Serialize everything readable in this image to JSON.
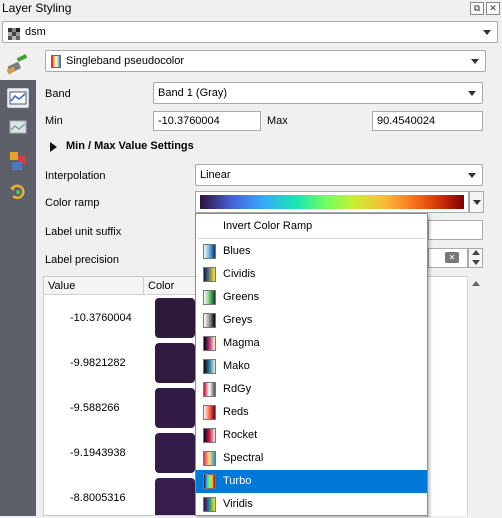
{
  "window": {
    "title": "Layer Styling",
    "float_glyph": "⧉",
    "close_glyph": "✕"
  },
  "layer_selector": {
    "value": "dsm"
  },
  "renderer": {
    "value": "Singleband pseudocolor"
  },
  "band": {
    "label": "Band",
    "value": "Band 1 (Gray)"
  },
  "min": {
    "label": "Min",
    "value": "-10.3760004"
  },
  "max": {
    "label": "Max",
    "value": "90.4540024"
  },
  "minmax_section": {
    "label": "Min / Max Value Settings"
  },
  "interpolation": {
    "label": "Interpolation",
    "value": "Linear"
  },
  "color_ramp": {
    "label": "Color ramp"
  },
  "label_unit_suffix": {
    "label": "Label unit suffix"
  },
  "label_precision": {
    "label": "Label precision"
  },
  "table": {
    "headers": [
      "Value",
      "Color"
    ],
    "rows": [
      {
        "value": "-10.3760004",
        "color": "#2e1a3a"
      },
      {
        "value": "-9.9821282",
        "color": "#301a3f"
      },
      {
        "value": "-9.588266",
        "color": "#321b44"
      },
      {
        "value": "-9.1943938",
        "color": "#341c48"
      },
      {
        "value": "-8.8005316",
        "color": "#361d4d"
      }
    ]
  },
  "ramp_menu": {
    "invert_label": "Invert Color Ramp",
    "items": [
      {
        "label": "Blues",
        "icon": "blues-ramp-icon"
      },
      {
        "label": "Cividis",
        "icon": "cividis-ramp-icon"
      },
      {
        "label": "Greens",
        "icon": "greens-ramp-icon"
      },
      {
        "label": "Greys",
        "icon": "greys-ramp-icon"
      },
      {
        "label": "Magma",
        "icon": "magma-ramp-icon"
      },
      {
        "label": "Mako",
        "icon": "mako-ramp-icon"
      },
      {
        "label": "RdGy",
        "icon": "rdgy-ramp-icon"
      },
      {
        "label": "Reds",
        "icon": "reds-ramp-icon"
      },
      {
        "label": "Rocket",
        "icon": "rocket-ramp-icon"
      },
      {
        "label": "Spectral",
        "icon": "spectral-ramp-icon"
      },
      {
        "label": "Turbo",
        "icon": "turbo-ramp-icon",
        "selected": true
      },
      {
        "label": "Viridis",
        "icon": "viridis-ramp-icon"
      }
    ]
  },
  "colors": {
    "selection": "#0078d7",
    "sidebar": "#5d6068"
  }
}
